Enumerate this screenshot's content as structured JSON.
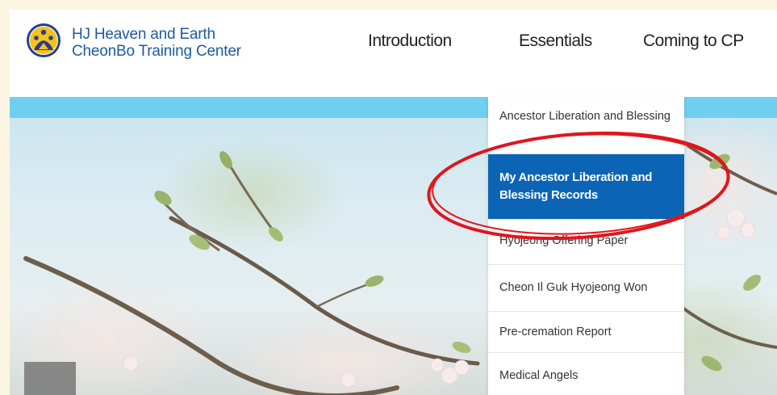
{
  "brand": {
    "line1": "HJ Heaven and Earth",
    "line2": "CheonBo Training Center",
    "logo_icon": "hj-cheonbo-logo-icon"
  },
  "nav": {
    "items": [
      {
        "label": "Introduction"
      },
      {
        "label": "Essentials"
      },
      {
        "label": "Coming to CP"
      }
    ]
  },
  "dropdown": {
    "items": [
      {
        "label": "Ancestor Liberation and Blessing",
        "active": false
      },
      {
        "label": "My Ancestor Liberation and Blessing Records",
        "active": true
      },
      {
        "label": "Hyojeong Offering Paper",
        "active": false
      },
      {
        "label": "Cheon Il Guk Hyojeong Won",
        "active": false
      },
      {
        "label": "Pre-cremation Report",
        "active": false
      },
      {
        "label": "Medical Angels",
        "active": false
      }
    ]
  },
  "colors": {
    "page_background": "#fdf5e3",
    "brand_blue": "#1e5aa0",
    "active_item": "#0b64b5",
    "highlight_circle": "#e0161b",
    "hero_topbar": "#6fcff0"
  }
}
